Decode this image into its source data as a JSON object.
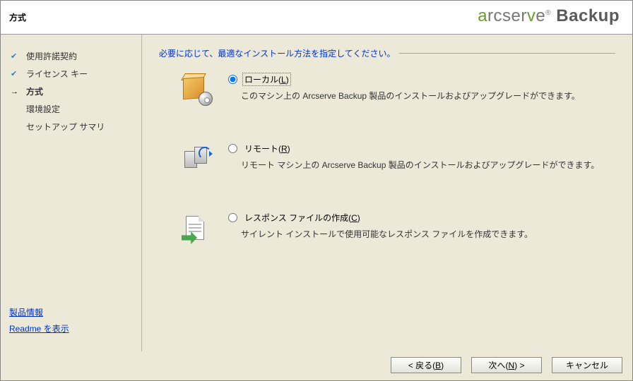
{
  "header": {
    "title": "方式",
    "brand_arc": "arcserve",
    "brand_backup": "Backup"
  },
  "sidebar": {
    "items": [
      {
        "label": "使用許諾契約",
        "state": "done"
      },
      {
        "label": "ライセンス キー",
        "state": "done"
      },
      {
        "label": "方式",
        "state": "current"
      },
      {
        "label": "環境設定",
        "state": "pending"
      },
      {
        "label": "セットアップ サマリ",
        "state": "pending"
      }
    ],
    "links": {
      "product_info": "製品情報",
      "readme": "Readme を表示"
    }
  },
  "main": {
    "instruction": "必要に応じて、最適なインストール方法を指定してください。",
    "options": [
      {
        "id": "local",
        "label_pre": "ローカル(",
        "accesskey": "L",
        "label_post": ")",
        "desc": "このマシン上の Arcserve Backup 製品のインストールおよびアップグレードができます。",
        "selected": true
      },
      {
        "id": "remote",
        "label_pre": "リモート(",
        "accesskey": "R",
        "label_post": ")",
        "desc": "リモート マシン上の Arcserve Backup 製品のインストールおよびアップグレードができます。",
        "selected": false
      },
      {
        "id": "response",
        "label_pre": "レスポンス ファイルの作成(",
        "accesskey": "C",
        "label_post": ")",
        "desc": "サイレント インストールで使用可能なレスポンス ファイルを作成できます。",
        "selected": false
      }
    ]
  },
  "footer": {
    "back_pre": "< 戻る(",
    "back_key": "B",
    "back_post": ")",
    "next_pre": "次へ(",
    "next_key": "N",
    "next_post": ") >",
    "cancel": "キャンセル"
  }
}
